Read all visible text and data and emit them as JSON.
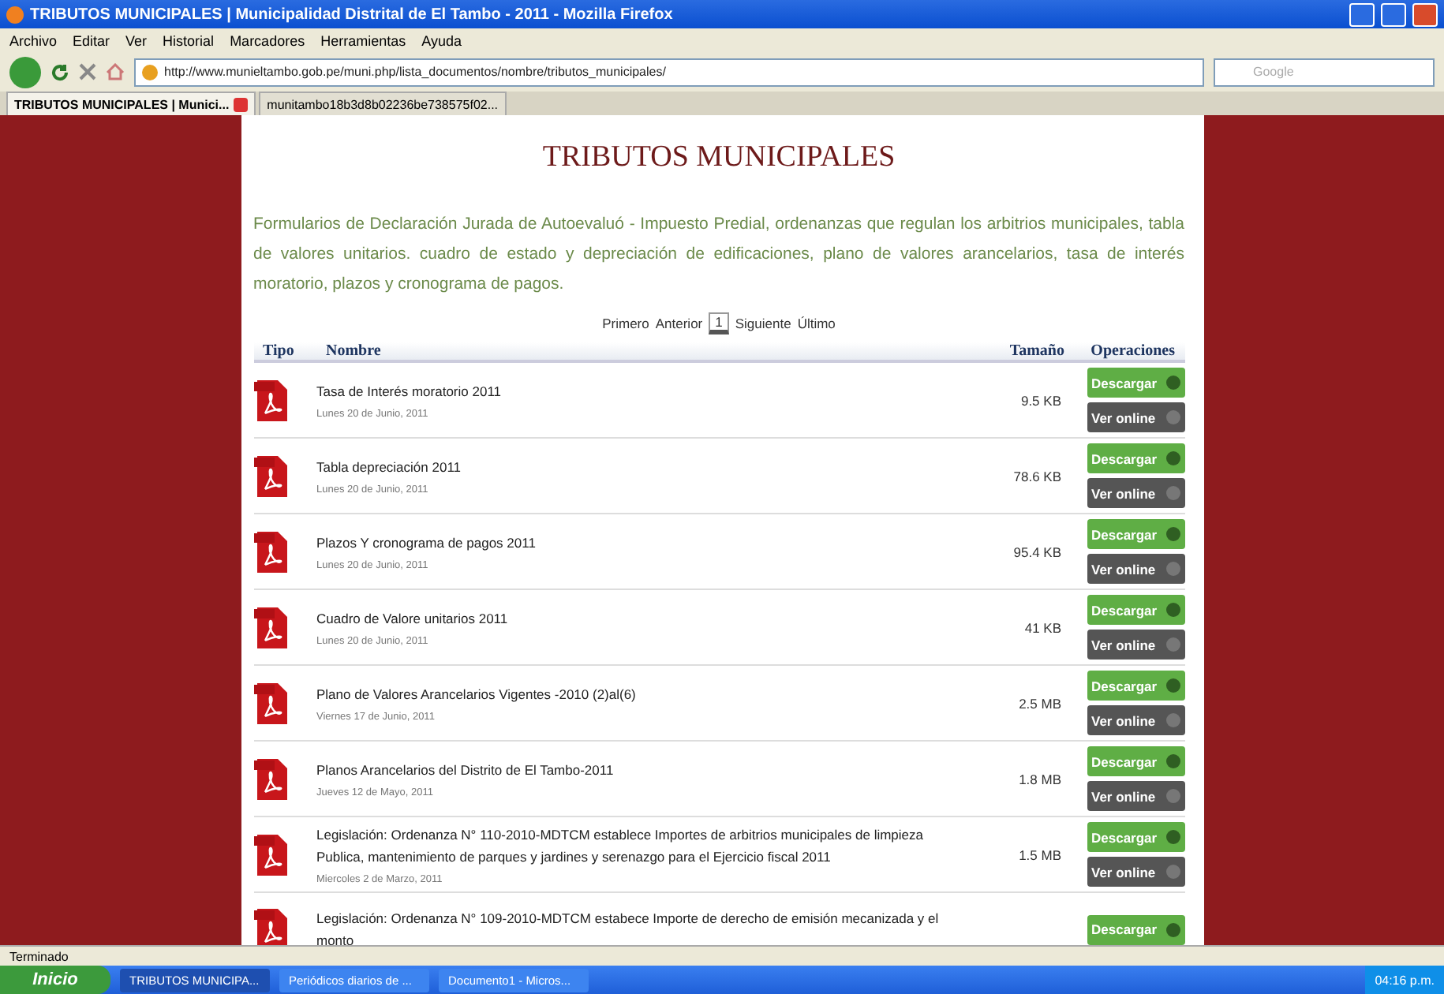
{
  "window": {
    "title": "TRIBUTOS MUNICIPALES | Municipalidad Distrital de El Tambo - 2011 - Mozilla Firefox"
  },
  "menu": [
    "Archivo",
    "Editar",
    "Ver",
    "Historial",
    "Marcadores",
    "Herramientas",
    "Ayuda"
  ],
  "address": {
    "value": "http://www.munieltambo.gob.pe/muni.php/lista_documentos/nombre/tributos_municipales/"
  },
  "search": {
    "placeholder": "Google"
  },
  "tabs": [
    {
      "label": "TRIBUTOS MUNICIPALES | Munici...",
      "selected": true
    },
    {
      "label": "munitambo18b3d8b02236be738575f02...",
      "selected": false
    }
  ],
  "page": {
    "title": "TRIBUTOS MUNICIPALES",
    "description": "Formularios de Declaración Jurada de Autoevaluó - Impuesto Predial, ordenanzas que regulan los arbitrios municipales, tabla de valores unitarios. cuadro de estado y depreciación de edificaciones, plano de valores arancelarios, tasa de interés moratorio, plazos y cronograma de pagos.",
    "pagination": [
      {
        "label": "Primero",
        "selected": false
      },
      {
        "label": "Anterior",
        "selected": false
      },
      {
        "label": "1",
        "selected": true
      },
      {
        "label": "Siguiente",
        "selected": false
      },
      {
        "label": "Último",
        "selected": false
      }
    ],
    "columns": [
      "Tipo",
      "Nombre",
      "Tamaño",
      "Operaciones"
    ],
    "rows": [
      {
        "name": "Tasa de Interés moratorio 2011",
        "date": "Lunes 20 de Junio, 2011",
        "size": "9.5 KB",
        "actions": [
          "Descargar",
          "Ver online"
        ]
      },
      {
        "name": "Tabla depreciación 2011",
        "date": "Lunes 20 de Junio, 2011",
        "size": "78.6 KB",
        "actions": [
          "Descargar",
          "Ver online"
        ]
      },
      {
        "name": "Plazos Y cronograma de pagos 2011",
        "date": "Lunes 20 de Junio, 2011",
        "size": "95.4 KB",
        "actions": [
          "Descargar",
          "Ver online"
        ]
      },
      {
        "name": "Cuadro de Valore unitarios 2011",
        "date": "Lunes 20 de Junio, 2011",
        "size": "41 KB",
        "actions": [
          "Descargar",
          "Ver online"
        ]
      },
      {
        "name": "Plano de Valores Arancelarios Vigentes -2010 (2)al(6)",
        "date": "Viernes 17 de Junio, 2011",
        "size": "2.5 MB",
        "actions": [
          "Descargar",
          "Ver online"
        ]
      },
      {
        "name": "Planos Arancelarios del Distrito de El Tambo-2011",
        "date": "Jueves 12 de Mayo, 2011",
        "size": "1.8 MB",
        "actions": [
          "Descargar",
          "Ver online"
        ]
      },
      {
        "name": "Legislación: Ordenanza N° 110-2010-MDTCM establece Importes de arbitrios municipales de limpieza Publica, mantenimiento de parques y jardines y serenazgo para el Ejercicio fiscal 2011",
        "date": "Miercoles 2 de Marzo, 2011",
        "size": "1.5 MB",
        "actions": [
          "Descargar",
          "Ver online"
        ]
      },
      {
        "name": "Legislación: Ordenanza N° 109-2010-MDTCM estabece Importe de derecho de emisión mecanizada y el monto",
        "actions": [
          "Descargar"
        ]
      }
    ]
  },
  "status_bar": "Terminado",
  "taskbar": {
    "start": "Inicio",
    "items": [
      {
        "label": "TRIBUTOS MUNICIPA...",
        "selected": true
      },
      {
        "label": "Periódicos diarios de ...",
        "selected": false
      },
      {
        "label": "Documento1 - Micros...",
        "selected": false
      }
    ],
    "clock": "04:16 p.m."
  }
}
